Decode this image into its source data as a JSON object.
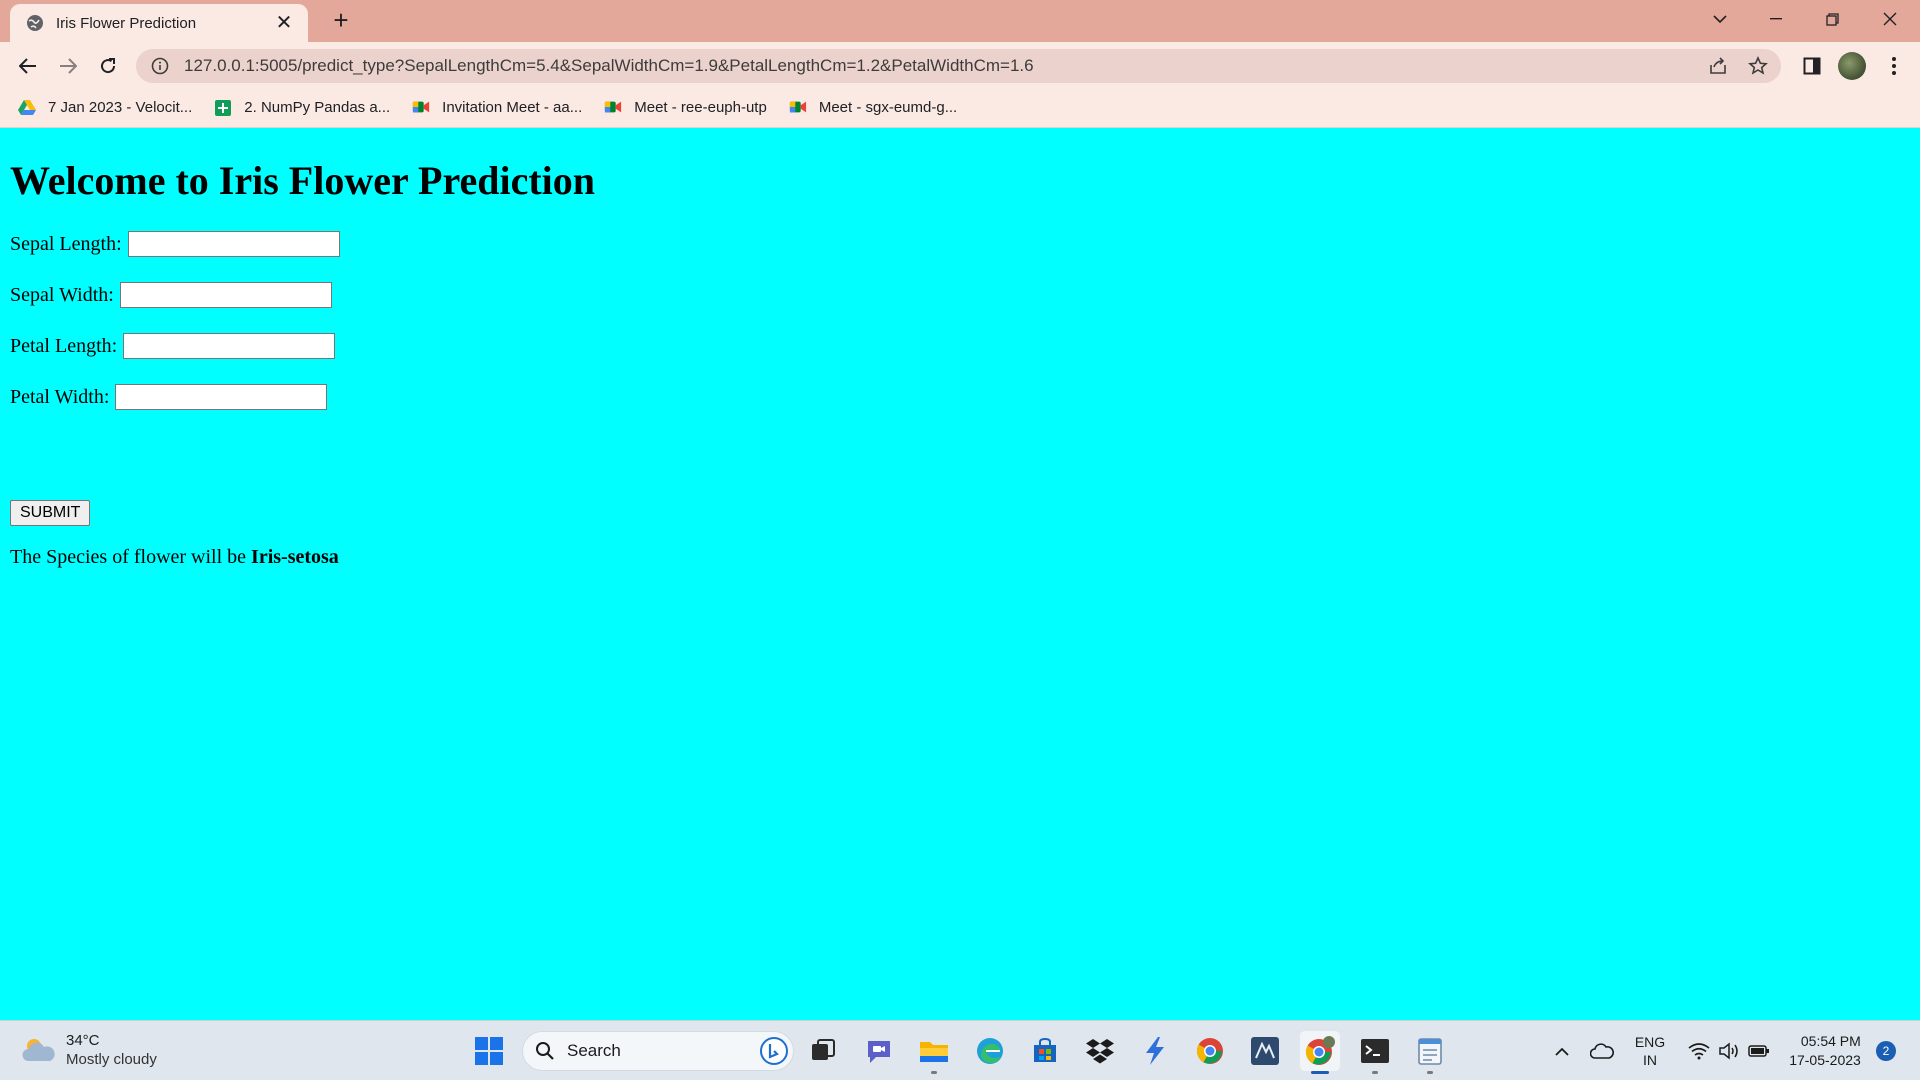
{
  "browser": {
    "tab_title": "Iris Flower Prediction",
    "url": "127.0.0.1:5005/predict_type?SepalLengthCm=5.4&SepalWidthCm=1.9&PetalLengthCm=1.2&PetalWidthCm=1.6",
    "new_tab_label": "+",
    "close_tab_label": "✕"
  },
  "bookmarks": [
    {
      "label": "7 Jan 2023 - Velocit...",
      "icon": "google-drive-icon"
    },
    {
      "label": "2. NumPy Pandas a...",
      "icon": "google-sheets-icon"
    },
    {
      "label": "Invitation Meet - aa...",
      "icon": "google-meet-icon"
    },
    {
      "label": "Meet - ree-euph-utp",
      "icon": "google-meet-icon"
    },
    {
      "label": "Meet - sgx-eumd-g...",
      "icon": "google-meet-icon"
    }
  ],
  "page": {
    "heading": "Welcome to Iris Flower Prediction",
    "fields": {
      "sepal_length": {
        "label": "Sepal Length:",
        "value": ""
      },
      "sepal_width": {
        "label": "Sepal Width:",
        "value": ""
      },
      "petal_length": {
        "label": "Petal Length:",
        "value": ""
      },
      "petal_width": {
        "label": "Petal Width:",
        "value": ""
      }
    },
    "submit_label": "SUBMIT",
    "result_prefix": "The Species of flower will be ",
    "result_value": "Iris-setosa"
  },
  "taskbar": {
    "weather_temp": "34°C",
    "weather_desc": "Mostly cloudy",
    "search_label": "Search",
    "lang_top": "ENG",
    "lang_bottom": "IN",
    "time": "05:54 PM",
    "date": "17-05-2023",
    "notification_count": "2"
  },
  "colors": {
    "page_background": "#00ffff",
    "tab_bar": "#e3a899",
    "toolbar": "#fbe9e4"
  }
}
